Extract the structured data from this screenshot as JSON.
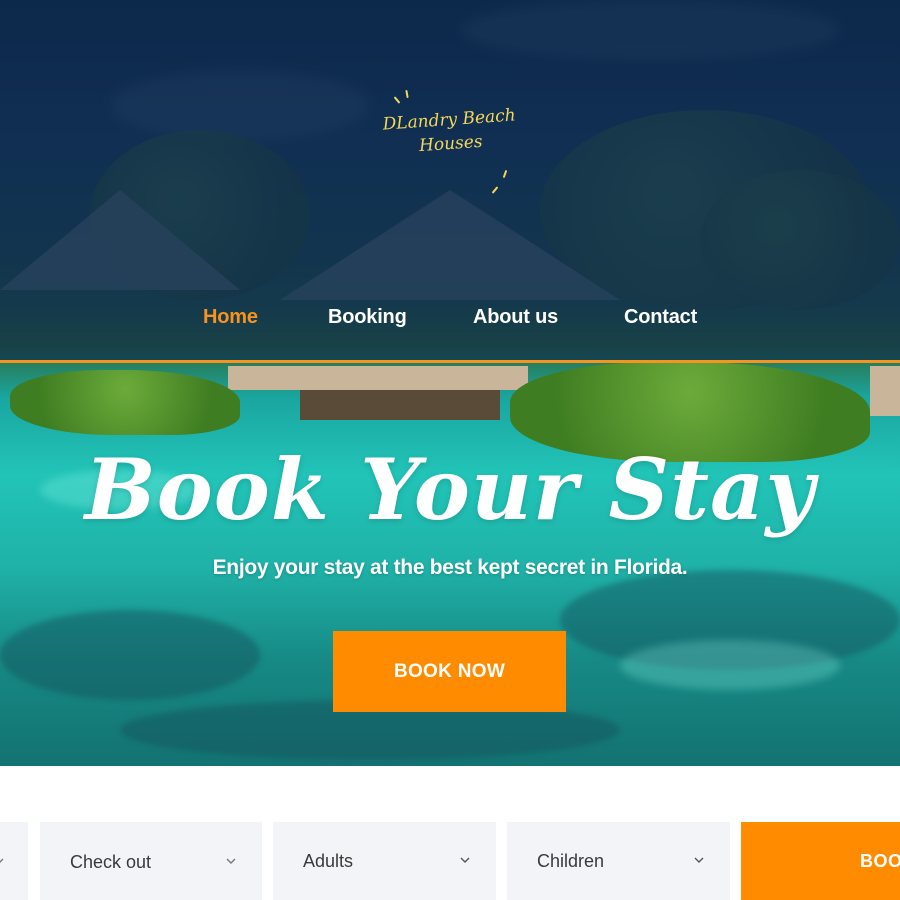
{
  "brand": {
    "logo_line1": "DLandry Beach",
    "logo_line2": "Houses",
    "accent_color": "#f7931e",
    "logo_color": "#f3d65a"
  },
  "nav": {
    "items": [
      {
        "label": "Home",
        "active": true
      },
      {
        "label": "Booking",
        "active": false
      },
      {
        "label": "About us",
        "active": false
      },
      {
        "label": "Contact",
        "active": false
      }
    ]
  },
  "hero": {
    "title": "Book Your Stay",
    "subtitle": "Enjoy your stay at the best kept secret in Florida.",
    "cta_label": "BOOK NOW"
  },
  "booking_form": {
    "fields": [
      {
        "label": "",
        "icon": "chevron-down-icon"
      },
      {
        "label": "Check out",
        "icon": "chevron-down-icon"
      },
      {
        "label": "Adults",
        "icon": "chevron-down-icon"
      },
      {
        "label": "Children",
        "icon": "chevron-down-icon"
      }
    ],
    "submit_label": "BOOK NOW",
    "submit_visible_text": "BOO"
  }
}
